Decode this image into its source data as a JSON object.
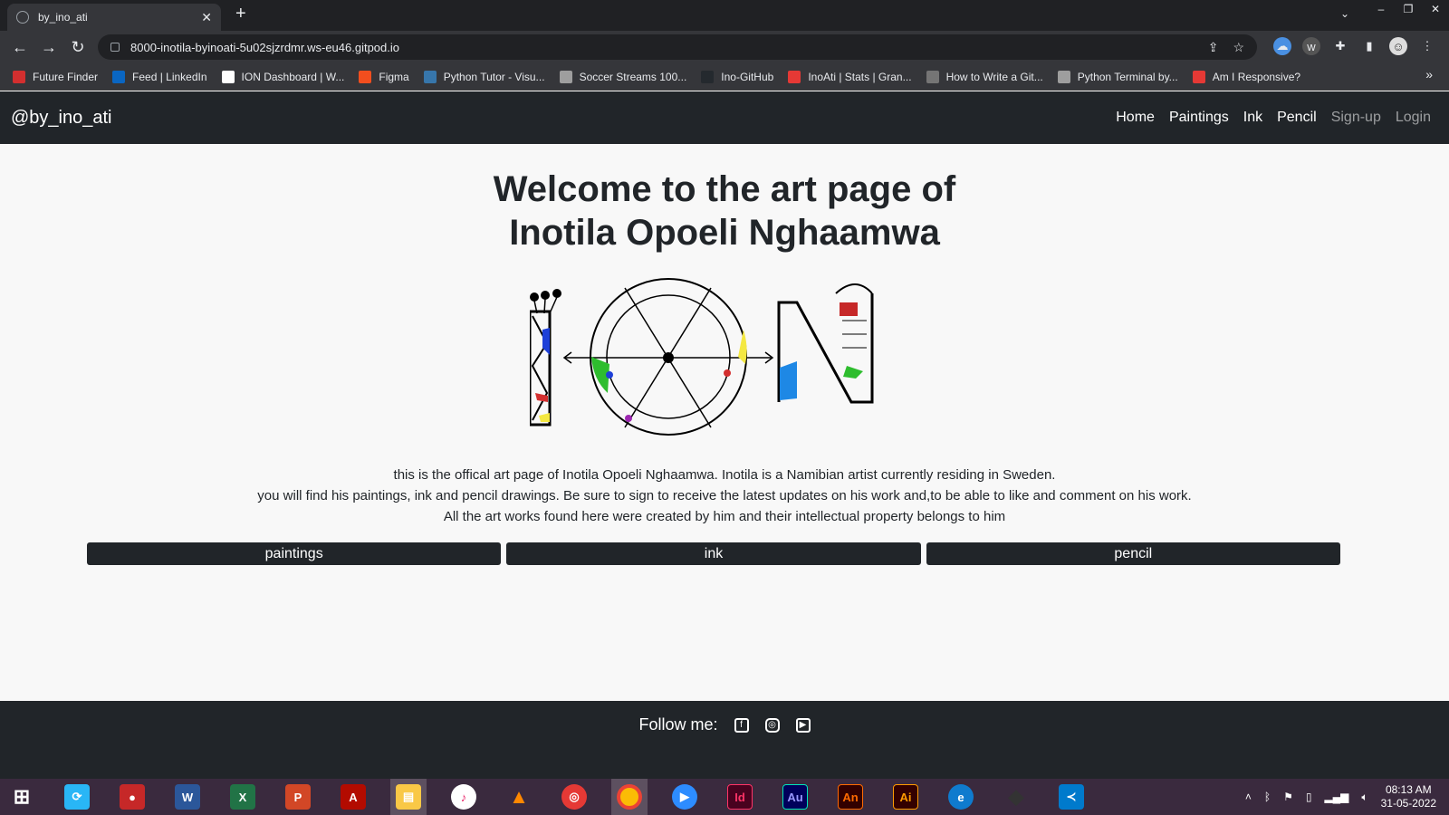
{
  "browser": {
    "tab_title": "by_ino_ati",
    "url": "8000-inotila-byinoati-5u02sjzrdmr.ws-eu46.gitpod.io",
    "bookmarks": [
      {
        "label": "Future Finder",
        "color": "#d32f2f"
      },
      {
        "label": "Feed | LinkedIn",
        "color": "#0a66c2"
      },
      {
        "label": "ION Dashboard | W...",
        "color": "#ffffff"
      },
      {
        "label": "Figma",
        "color": "#f24e1e"
      },
      {
        "label": "Python Tutor - Visu...",
        "color": "#3776ab"
      },
      {
        "label": "Soccer Streams 100...",
        "color": "#9e9e9e"
      },
      {
        "label": "Ino-GitHub",
        "color": "#24292e"
      },
      {
        "label": "InoAti | Stats | Gran...",
        "color": "#e53935"
      },
      {
        "label": "How to Write a Git...",
        "color": "#757575"
      },
      {
        "label": "Python Terminal by...",
        "color": "#9e9e9e"
      },
      {
        "label": "Am I Responsive?",
        "color": "#e53935"
      }
    ]
  },
  "site": {
    "brand": "@by_ino_ati",
    "nav": {
      "home": "Home",
      "paintings": "Paintings",
      "ink": "Ink",
      "pencil": "Pencil",
      "signup": "Sign-up",
      "login": "Login"
    },
    "heading_line1": "Welcome to the art page of",
    "heading_line2": "Inotila Opoeli Nghaamwa",
    "intro": [
      "this is the offical art page of Inotila Opoeli Nghaamwa. Inotila is a Namibian artist currently residing in Sweden.",
      "you will find his paintings, ink and pencil drawings. Be sure to sign to receive the latest updates on his work and,to be able to like and comment on his work.",
      "All the art works found here were created by him and their intellectual property belongs to him"
    ],
    "buttons": {
      "paintings": "paintings",
      "ink": "ink",
      "pencil": "pencil"
    },
    "footer": {
      "follow": "Follow me:"
    }
  },
  "taskbar": {
    "time": "08:13 AM",
    "date": "31-05-2022",
    "apps": [
      {
        "name": "word",
        "label": "W",
        "color": "#2b579a"
      },
      {
        "name": "excel",
        "label": "X",
        "color": "#217346"
      },
      {
        "name": "powerpoint",
        "label": "P",
        "color": "#d24726"
      },
      {
        "name": "acrobat",
        "label": "A",
        "color": "#b30b00"
      },
      {
        "name": "indesign",
        "label": "Id",
        "color": "#49021f"
      },
      {
        "name": "audition",
        "label": "Au",
        "color": "#00005b"
      },
      {
        "name": "animate",
        "label": "An",
        "color": "#330000"
      },
      {
        "name": "illustrator",
        "label": "Ai",
        "color": "#330000"
      }
    ]
  }
}
